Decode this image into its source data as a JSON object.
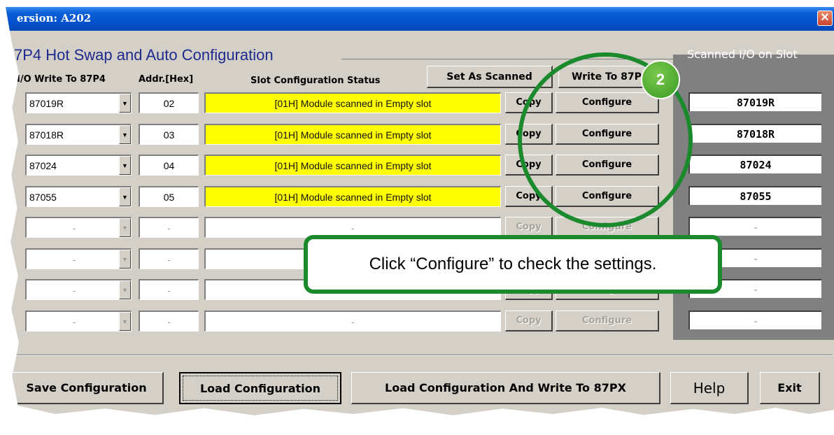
{
  "window": {
    "title": "ersion: A202",
    "close_label": "✕"
  },
  "group_title": "7P4 Hot Swap and Auto Configuration",
  "headers": {
    "io_write": "I/O Write To 87P4",
    "addr": "Addr.[Hex]",
    "status": "Slot Configuration Status",
    "set_as_scanned": "Set As Scanned",
    "write_to": "Write To 87P",
    "scanned_title": "Scanned I/O on Slot"
  },
  "rows": [
    {
      "module": "87019R",
      "addr": "02",
      "status": "[01H] Module scanned in Empty slot",
      "copy": "Copy",
      "configure": "Configure",
      "scanned": "87019R",
      "enabled": true
    },
    {
      "module": "87018R",
      "addr": "03",
      "status": "[01H] Module scanned in Empty slot",
      "copy": "Copy",
      "configure": "Configure",
      "scanned": "87018R",
      "enabled": true
    },
    {
      "module": "87024",
      "addr": "04",
      "status": "[01H] Module scanned in Empty slot",
      "copy": "Copy",
      "configure": "Configure",
      "scanned": "87024",
      "enabled": true
    },
    {
      "module": "87055",
      "addr": "05",
      "status": "[01H] Module scanned in Empty slot",
      "copy": "Copy",
      "configure": "Configure",
      "scanned": "87055",
      "enabled": true
    },
    {
      "module": "-",
      "addr": "-",
      "status": "-",
      "copy": "Copy",
      "configure": "Configure",
      "scanned": "-",
      "enabled": false
    },
    {
      "module": "-",
      "addr": "-",
      "status": "-",
      "copy": "Copy",
      "configure": "Configure",
      "scanned": "-",
      "enabled": false
    },
    {
      "module": "-",
      "addr": "-",
      "status": "-",
      "copy": "Copy",
      "configure": "Configure",
      "scanned": "-",
      "enabled": false
    },
    {
      "module": "-",
      "addr": "-",
      "status": "-",
      "copy": "Copy",
      "configure": "Configure",
      "scanned": "-",
      "enabled": false
    }
  ],
  "bottom_buttons": {
    "save": "Save Configuration",
    "load": "Load Configuration",
    "load_write": "Load  Configuration And Write To 87PX",
    "help": "Help",
    "exit": "Exit"
  },
  "annotation": {
    "step_number": "2",
    "callout_text": "Click “Configure” to check the settings.",
    "color": "#1a8a2c"
  }
}
